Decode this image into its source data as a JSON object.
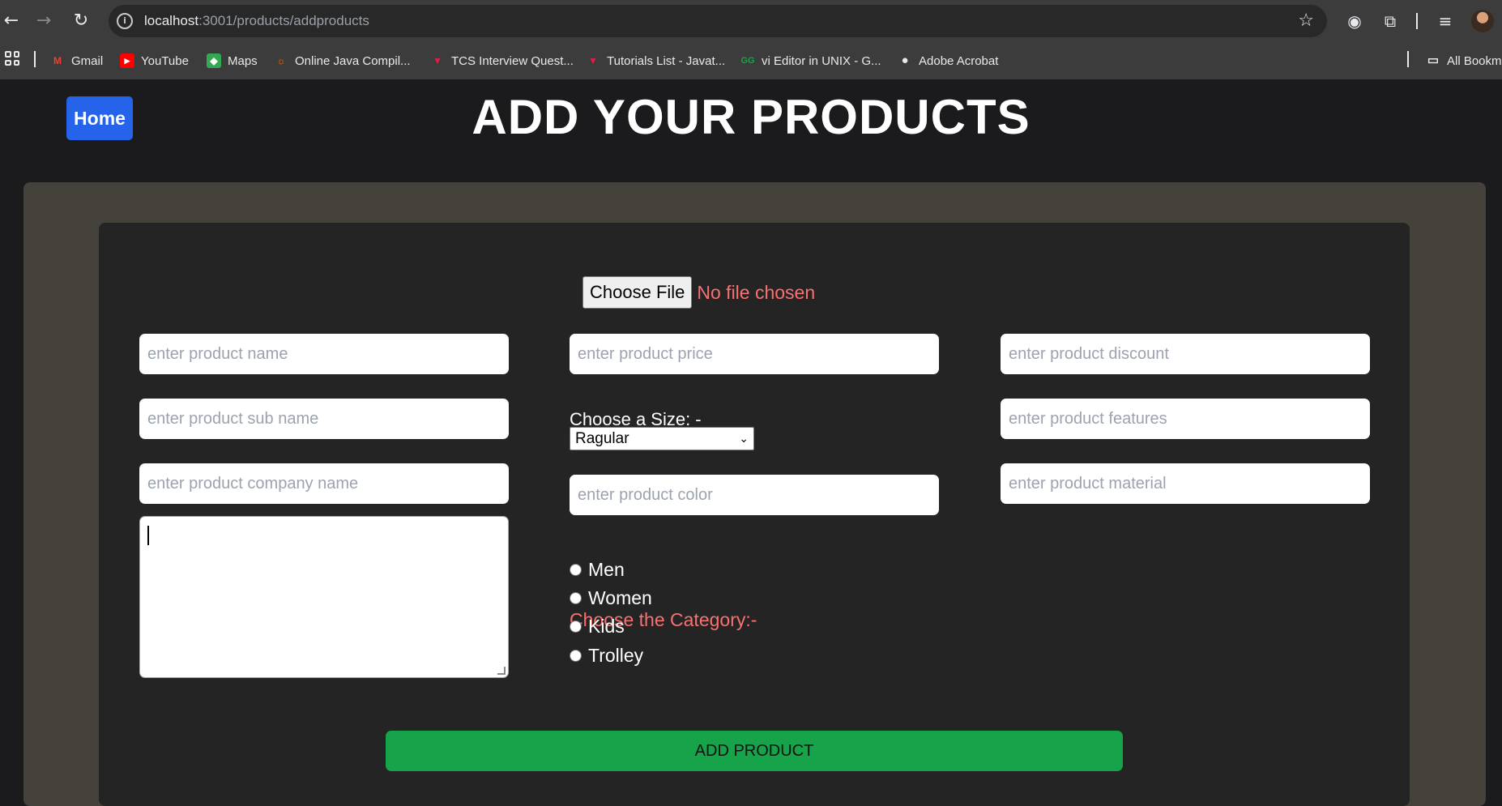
{
  "browser": {
    "url_host": "localhost",
    "url_path": ":3001/products/addproducts",
    "bookmarks": [
      {
        "label": "Gmail",
        "icon": "gmail-icon",
        "color": "#ea4335"
      },
      {
        "label": "YouTube",
        "icon": "youtube-icon",
        "color": "#ff0000"
      },
      {
        "label": "Maps",
        "icon": "maps-icon",
        "color": "#34a853"
      },
      {
        "label": "Online Java Compil...",
        "icon": "sun-icon",
        "color": "#f97316"
      },
      {
        "label": "TCS Interview Quest...",
        "icon": "v-logo-icon",
        "color": "#e11d48"
      },
      {
        "label": "Tutorials List - Javat...",
        "icon": "v-logo-icon",
        "color": "#e11d48"
      },
      {
        "label": "vi Editor in UNIX - G...",
        "icon": "gfg-icon",
        "color": "#16a34a"
      },
      {
        "label": "Adobe Acrobat",
        "icon": "globe-icon",
        "color": "#e8eaed"
      }
    ],
    "all_bookmarks": "All Bookm"
  },
  "page": {
    "home_label": "Home",
    "title": "ADD YOUR PRODUCTS"
  },
  "form": {
    "choose_file_label": "Choose File",
    "no_file_text": "No file chosen",
    "product_name_placeholder": "enter product name",
    "product_sub_name_placeholder": "enter product sub name",
    "company_name_placeholder": "enter product company name",
    "price_placeholder": "enter product price",
    "size_label": "Choose a Size: -",
    "size_selected": "Ragular",
    "color_placeholder": "enter product color",
    "category_label": "Choose the Category:-",
    "categories": [
      "Men",
      "Women",
      "Kids",
      "Trolley"
    ],
    "discount_placeholder": "enter product discount",
    "features_placeholder": "enter product features",
    "material_placeholder": "enter product material",
    "submit_label": "ADD PRODUCT"
  },
  "colors": {
    "home_button": "#2563eb",
    "submit_button": "#16a34a",
    "accent_red": "#f87171"
  }
}
